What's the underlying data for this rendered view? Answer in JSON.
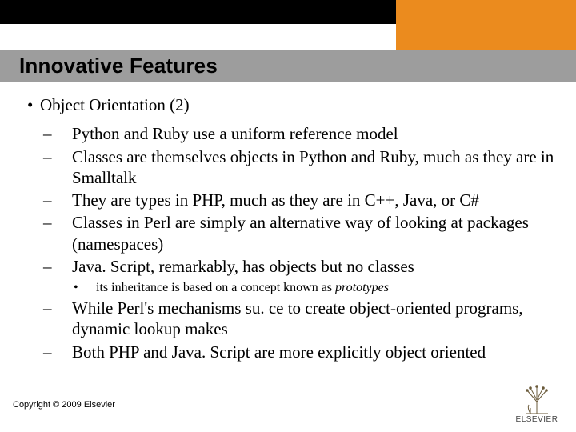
{
  "title": "Innovative Features",
  "main": {
    "heading": "Object Orientation (2)",
    "items": [
      "Python and Ruby use a uniform reference model",
      "Classes are themselves objects in Python and Ruby, much as they are in Smalltalk",
      "They are types in PHP, much as they are in C++, Java, or C#",
      "Classes in Perl are simply an alternative way of looking at packages (namespaces)",
      "Java. Script, remarkably, has objects but no classes"
    ],
    "sub_a": "its inheritance is based on a concept known as ",
    "sub_em": "prototypes",
    "items2": [
      "While Perl's mechanisms su. ce to create object-oriented programs, dynamic lookup makes",
      "Both PHP and Java. Script are more explicitly object oriented"
    ]
  },
  "footer": {
    "copyright": "Copyright © 2009 Elsevier",
    "brand": "ELSEVIER"
  }
}
